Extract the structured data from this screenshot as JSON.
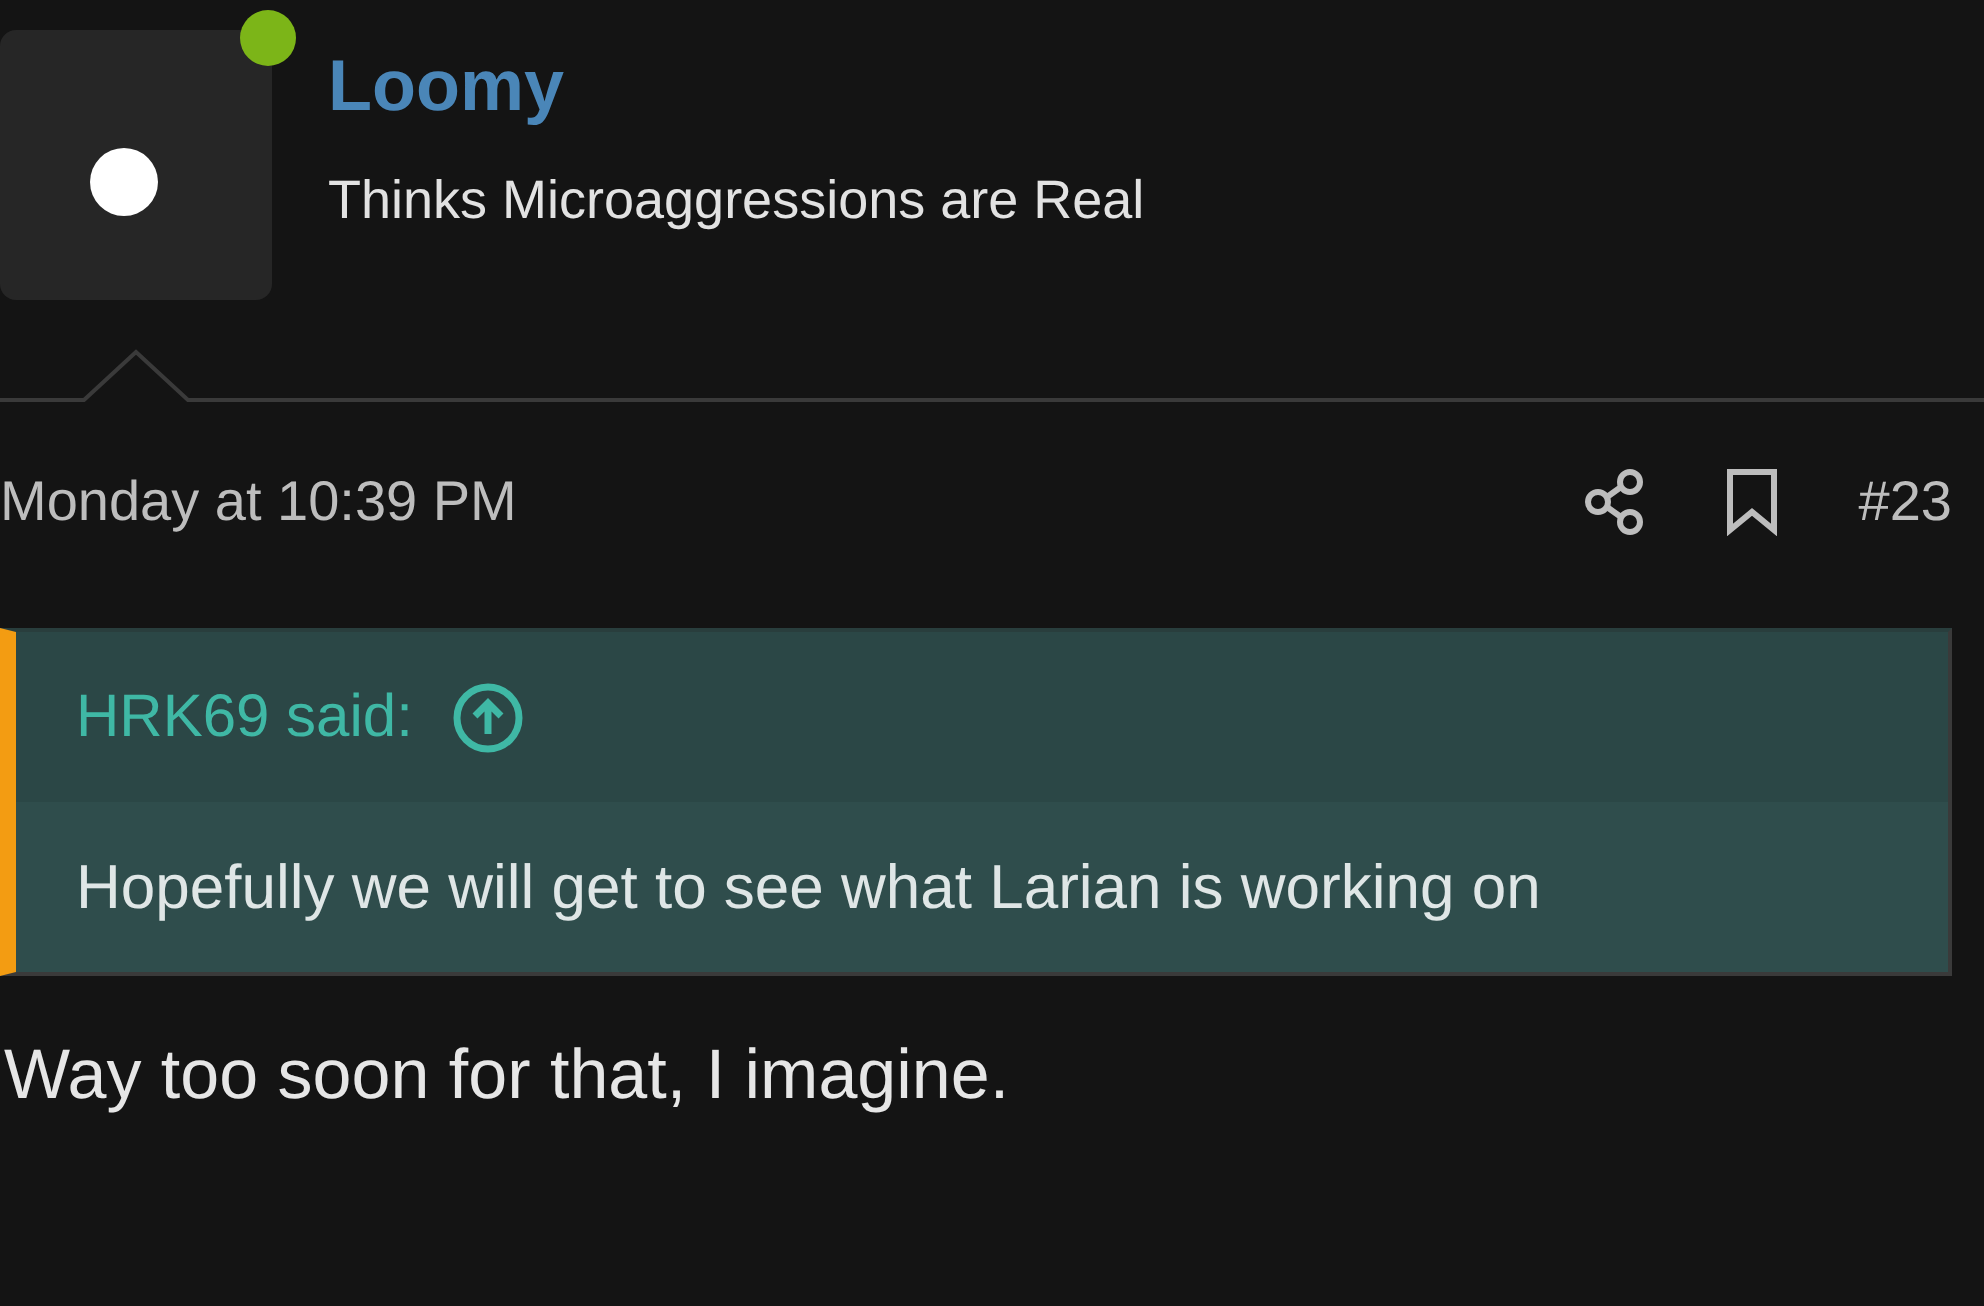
{
  "author": {
    "name": "Loomy",
    "title": "Thinks Microaggressions are Real",
    "online": true
  },
  "post": {
    "date": "Monday at 10:39 PM",
    "number": "#23"
  },
  "quote": {
    "attribution": "HRK69 said:",
    "text": "Hopefully we will get to see what Larian is working on"
  },
  "body": "Way too soon for that, I imagine."
}
